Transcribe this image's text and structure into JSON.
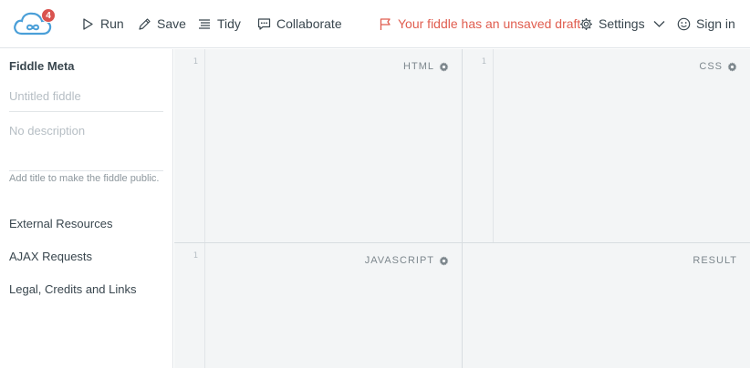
{
  "header": {
    "notification_count": "4",
    "run_label": "Run",
    "save_label": "Save",
    "tidy_label": "Tidy",
    "collaborate_label": "Collaborate",
    "draft_label": "Your fiddle has an unsaved draft",
    "settings_label": "Settings",
    "signin_label": "Sign in"
  },
  "sidebar": {
    "meta_title": "Fiddle Meta",
    "title_placeholder": "Untitled fiddle",
    "description_placeholder": "No description",
    "hint": "Add title to make the fiddle public.",
    "links": [
      "External Resources",
      "AJAX Requests",
      "Legal, Credits and Links"
    ]
  },
  "panels": {
    "html_label": "HTML",
    "css_label": "CSS",
    "js_label": "JAVASCRIPT",
    "result_label": "RESULT",
    "line_number": "1"
  },
  "colors": {
    "brand": "#4a9fd8",
    "badge": "#d9534f",
    "draft": "#e05d4f",
    "panel_bg": "#f3f5f6"
  }
}
